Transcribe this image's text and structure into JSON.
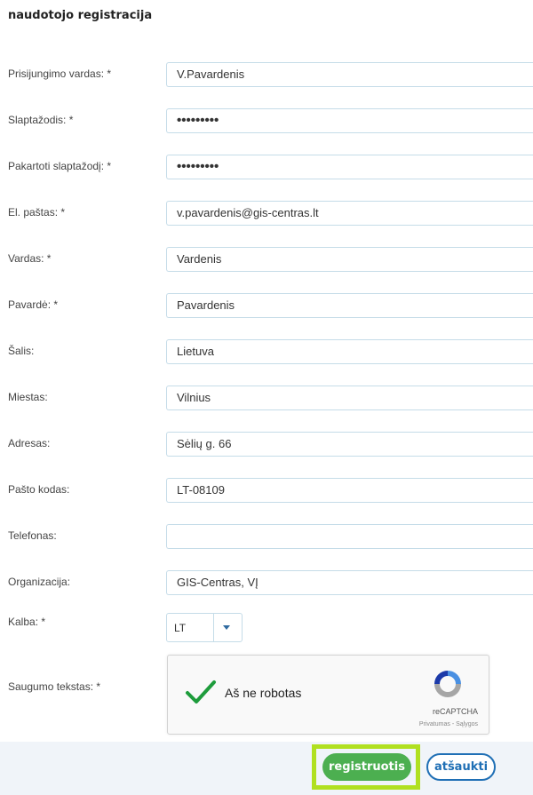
{
  "title": "naudotojo registracija",
  "fields": [
    {
      "label": "Prisijungimo vardas: *",
      "value": "V.Pavardenis"
    },
    {
      "label": "Slaptažodis: *",
      "value": "•••••••••"
    },
    {
      "label": "Pakartoti slaptažodį: *",
      "value": "•••••••••"
    },
    {
      "label": "El. paštas: *",
      "value": "v.pavardenis@gis-centras.lt"
    },
    {
      "label": "Vardas: *",
      "value": "Vardenis"
    },
    {
      "label": "Pavardė: *",
      "value": "Pavardenis"
    },
    {
      "label": "Šalis:",
      "value": "Lietuva"
    },
    {
      "label": "Miestas:",
      "value": "Vilnius"
    },
    {
      "label": "Adresas:",
      "value": "Sėlių g. 66"
    },
    {
      "label": "Pašto kodas:",
      "value": "LT-08109"
    },
    {
      "label": "Telefonas:",
      "value": ""
    },
    {
      "label": "Organizacija:",
      "value": "GIS-Centras, VĮ"
    }
  ],
  "language": {
    "label": "Kalba: *",
    "value": "LT"
  },
  "captcha": {
    "label": "Saugumo tekstas: *",
    "text": "Aš ne robotas",
    "brand": "reCAPTCHA",
    "links": "Privatumas - Sąlygos"
  },
  "buttons": {
    "register": "registruotis",
    "cancel": "atšaukti"
  },
  "colors": {
    "accent_green": "#4caf50",
    "accent_blue": "#1f6fb5",
    "highlight": "#b0e020"
  }
}
